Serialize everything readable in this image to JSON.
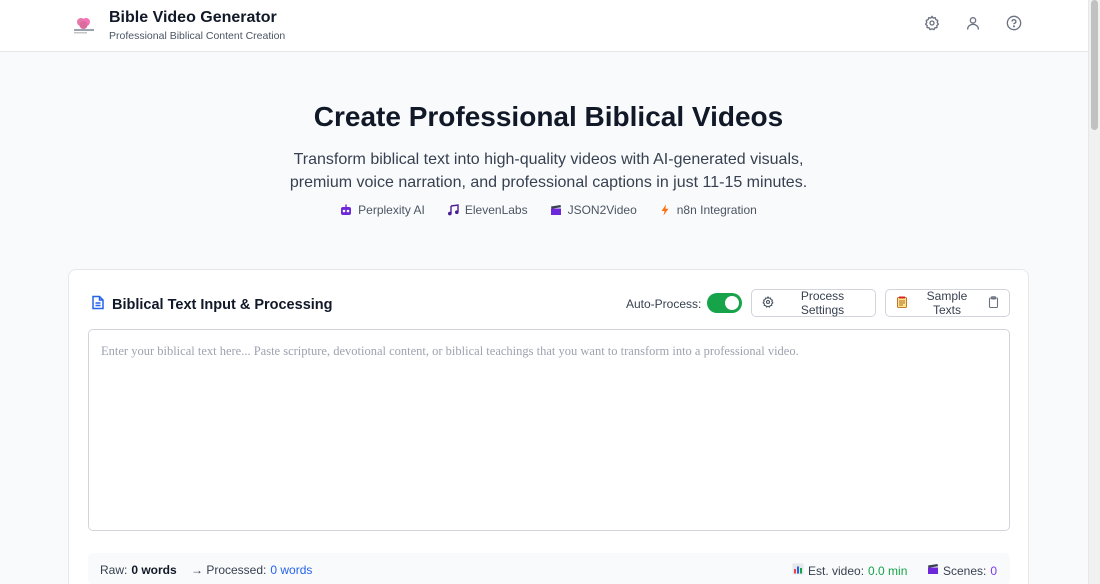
{
  "header": {
    "title": "Bible Video Generator",
    "subtitle": "Professional Biblical Content Creation",
    "logo_icon": "brain-logo-icon",
    "actions": [
      "gear-icon",
      "user-icon",
      "help-icon"
    ]
  },
  "hero": {
    "title": "Create Professional Biblical Videos",
    "description_line1": "Transform biblical text into high-quality videos with AI-generated visuals,",
    "description_line2": "premium voice narration, and professional captions in just 11-15 minutes.",
    "badges": [
      {
        "icon": "robot-icon",
        "label": "Perplexity AI"
      },
      {
        "icon": "music-note-icon",
        "label": "ElevenLabs"
      },
      {
        "icon": "clapperboard-icon",
        "label": "JSON2Video"
      },
      {
        "icon": "lightning-icon",
        "label": "n8n Integration"
      }
    ]
  },
  "input_card": {
    "title": "Biblical Text Input & Processing",
    "auto_process_label": "Auto-Process:",
    "auto_process_enabled": true,
    "process_settings_label": "Process Settings",
    "sample_texts_label": "Sample Texts",
    "text_value": "",
    "placeholder": "Enter your biblical text here... Paste scripture, devotional content, or biblical teachings that you want to transform into a professional video."
  },
  "stats": {
    "raw_label": "Raw:",
    "raw_value": "0 words",
    "processed_label": "→ Processed:",
    "processed_value": "0 words",
    "est_video_label": "Est. video:",
    "est_video_value": "0.0 min",
    "scenes_label": "Scenes:",
    "scenes_value": "0"
  },
  "colors": {
    "accent_green": "#16a34a",
    "accent_blue": "#2563eb",
    "accent_purple": "#7c3aed"
  }
}
